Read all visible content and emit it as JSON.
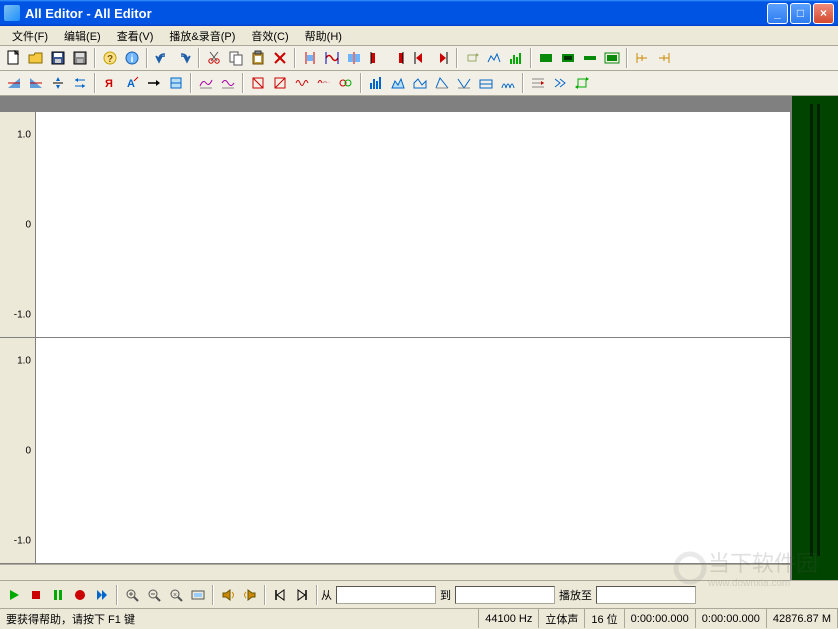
{
  "window": {
    "title": "All Editor - All Editor"
  },
  "menu": {
    "file": "文件(F)",
    "edit": "编辑(E)",
    "view": "查看(V)",
    "play_record": "播放&录音(P)",
    "effects": "音效(C)",
    "help": "帮助(H)"
  },
  "toolbar1": {
    "new": "new",
    "open": "open",
    "save": "save",
    "saveas": "saveas",
    "help": "help",
    "about": "about",
    "undo": "undo",
    "redo": "redo",
    "cut": "cut",
    "copy": "copy",
    "paste": "paste",
    "delete": "delete",
    "trim": "trim",
    "selall": "selall",
    "invert": "invert",
    "mark_start": "mark-start",
    "mark_end": "mark-end",
    "prev": "prev",
    "next": "next",
    "repeat": "repeat",
    "analyze": "analyze",
    "spectrum": "spectrum",
    "zoom_sel": "zoom-sel",
    "zoom_in": "zoom-in",
    "zoom_out": "zoom-out",
    "zoom_full": "zoom-full",
    "snap": "snap",
    "grid": "grid"
  },
  "toolbar2": {
    "fadein": "fadein",
    "fadeout": "fadeout",
    "normalize": "normalize",
    "reverse": "reverse",
    "silence": "silence",
    "amplify": "amplify",
    "arrow": "arrow",
    "process": "process",
    "eq1": "eq1",
    "eq2": "eq2",
    "filter1": "filter1",
    "filter2": "filter2",
    "chorus": "chorus",
    "delay": "delay",
    "echo": "echo",
    "env1": "env1",
    "env2": "env2",
    "env3": "env3",
    "env4": "env4",
    "env5": "env5",
    "env6": "env6",
    "env7": "env7",
    "stretch": "stretch",
    "phase": "phase",
    "loop": "loop"
  },
  "track_labels": {
    "pos_one": "1.0",
    "zero": "0",
    "neg_one": "-1.0"
  },
  "transport": {
    "from_label": "从",
    "to_label": "到",
    "playto_label": "播放至",
    "from_value": "",
    "to_value": "",
    "playto_value": ""
  },
  "status": {
    "help": "要获得帮助，请按下 F1 键",
    "rate": "44100 Hz",
    "channels": "立体声",
    "bits": "16 位",
    "time1": "0:00:00.000",
    "time2": "0:00:00.000",
    "ram": "42876.87 M"
  },
  "watermark": {
    "text": "当下软件园",
    "url": "www.downxia.com"
  }
}
